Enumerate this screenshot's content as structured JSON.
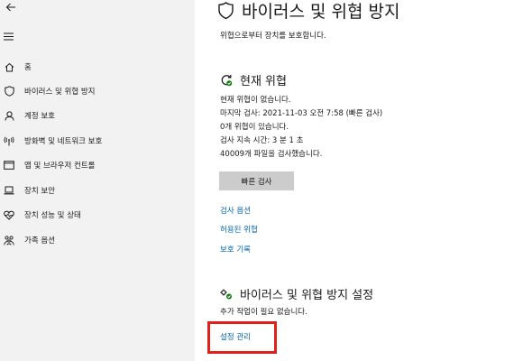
{
  "nav": {
    "items": [
      {
        "label": "홈",
        "icon": "home-icon"
      },
      {
        "label": "바이러스 및 위협 방지",
        "icon": "shield-icon"
      },
      {
        "label": "계정 보호",
        "icon": "person-icon"
      },
      {
        "label": "방화벽 및 네트워크 보호",
        "icon": "antenna-icon"
      },
      {
        "label": "앱 및 브라우저 컨트롤",
        "icon": "browser-window-icon"
      },
      {
        "label": "장치 보안",
        "icon": "laptop-icon"
      },
      {
        "label": "장치 성능 및 상태",
        "icon": "heart-pulse-icon"
      },
      {
        "label": "가족 옵션",
        "icon": "family-icon"
      }
    ]
  },
  "page": {
    "title": "바이러스 및 위협 방지",
    "subtitle": "위협으로부터 장치를 보호합니다."
  },
  "current_threats": {
    "title": "현재 위협",
    "lines": [
      "현재 위협이 없습니다.",
      "마지막 검사: 2021-11-03 오전 7:58 (빠른 검사)",
      "0개 위협이 있습니다.",
      "검사 지속 시간: 3 분 1 초",
      "40009개 파일을 검사했습니다."
    ],
    "quick_scan_label": "빠른 검사",
    "links": [
      "검사 옵션",
      "허용된 위협",
      "보호 기록"
    ]
  },
  "settings": {
    "title": "바이러스 및 위협 방지 설정",
    "status": "추가 작업이 필요 없습니다.",
    "manage_link": "설정 관리"
  },
  "colors": {
    "link": "#0067b8",
    "highlight": "#e0201b",
    "sidebar_bg": "#f2f2f2",
    "button_bg": "#cccccc"
  }
}
